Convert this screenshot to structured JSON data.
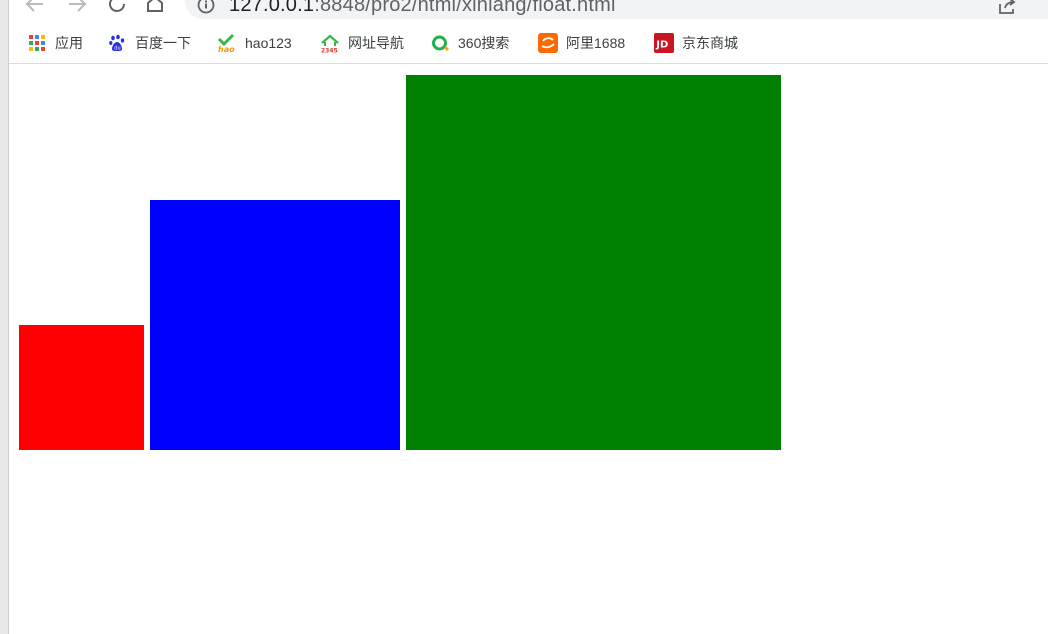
{
  "browser": {
    "url_host": "127.0.0.1",
    "url_rest": ":8848/pro2/html/xinlang/float.html"
  },
  "bookmarks": [
    {
      "label": "应用",
      "icon": "apps-grid-icon"
    },
    {
      "label": "百度一下",
      "icon": "baidu-paw-icon"
    },
    {
      "label": "hao123",
      "icon": "hao123-icon"
    },
    {
      "label": "网址导航",
      "icon": "2345-house-icon"
    },
    {
      "label": "360搜索",
      "icon": "360-search-icon"
    },
    {
      "label": "阿里1688",
      "icon": "alibaba-1688-icon"
    },
    {
      "label": "京东商城",
      "icon": "jd-icon"
    }
  ],
  "boxes": [
    {
      "name": "red",
      "color": "#ff0000"
    },
    {
      "name": "blue",
      "color": "#0000ff"
    },
    {
      "name": "green",
      "color": "#008000"
    }
  ]
}
